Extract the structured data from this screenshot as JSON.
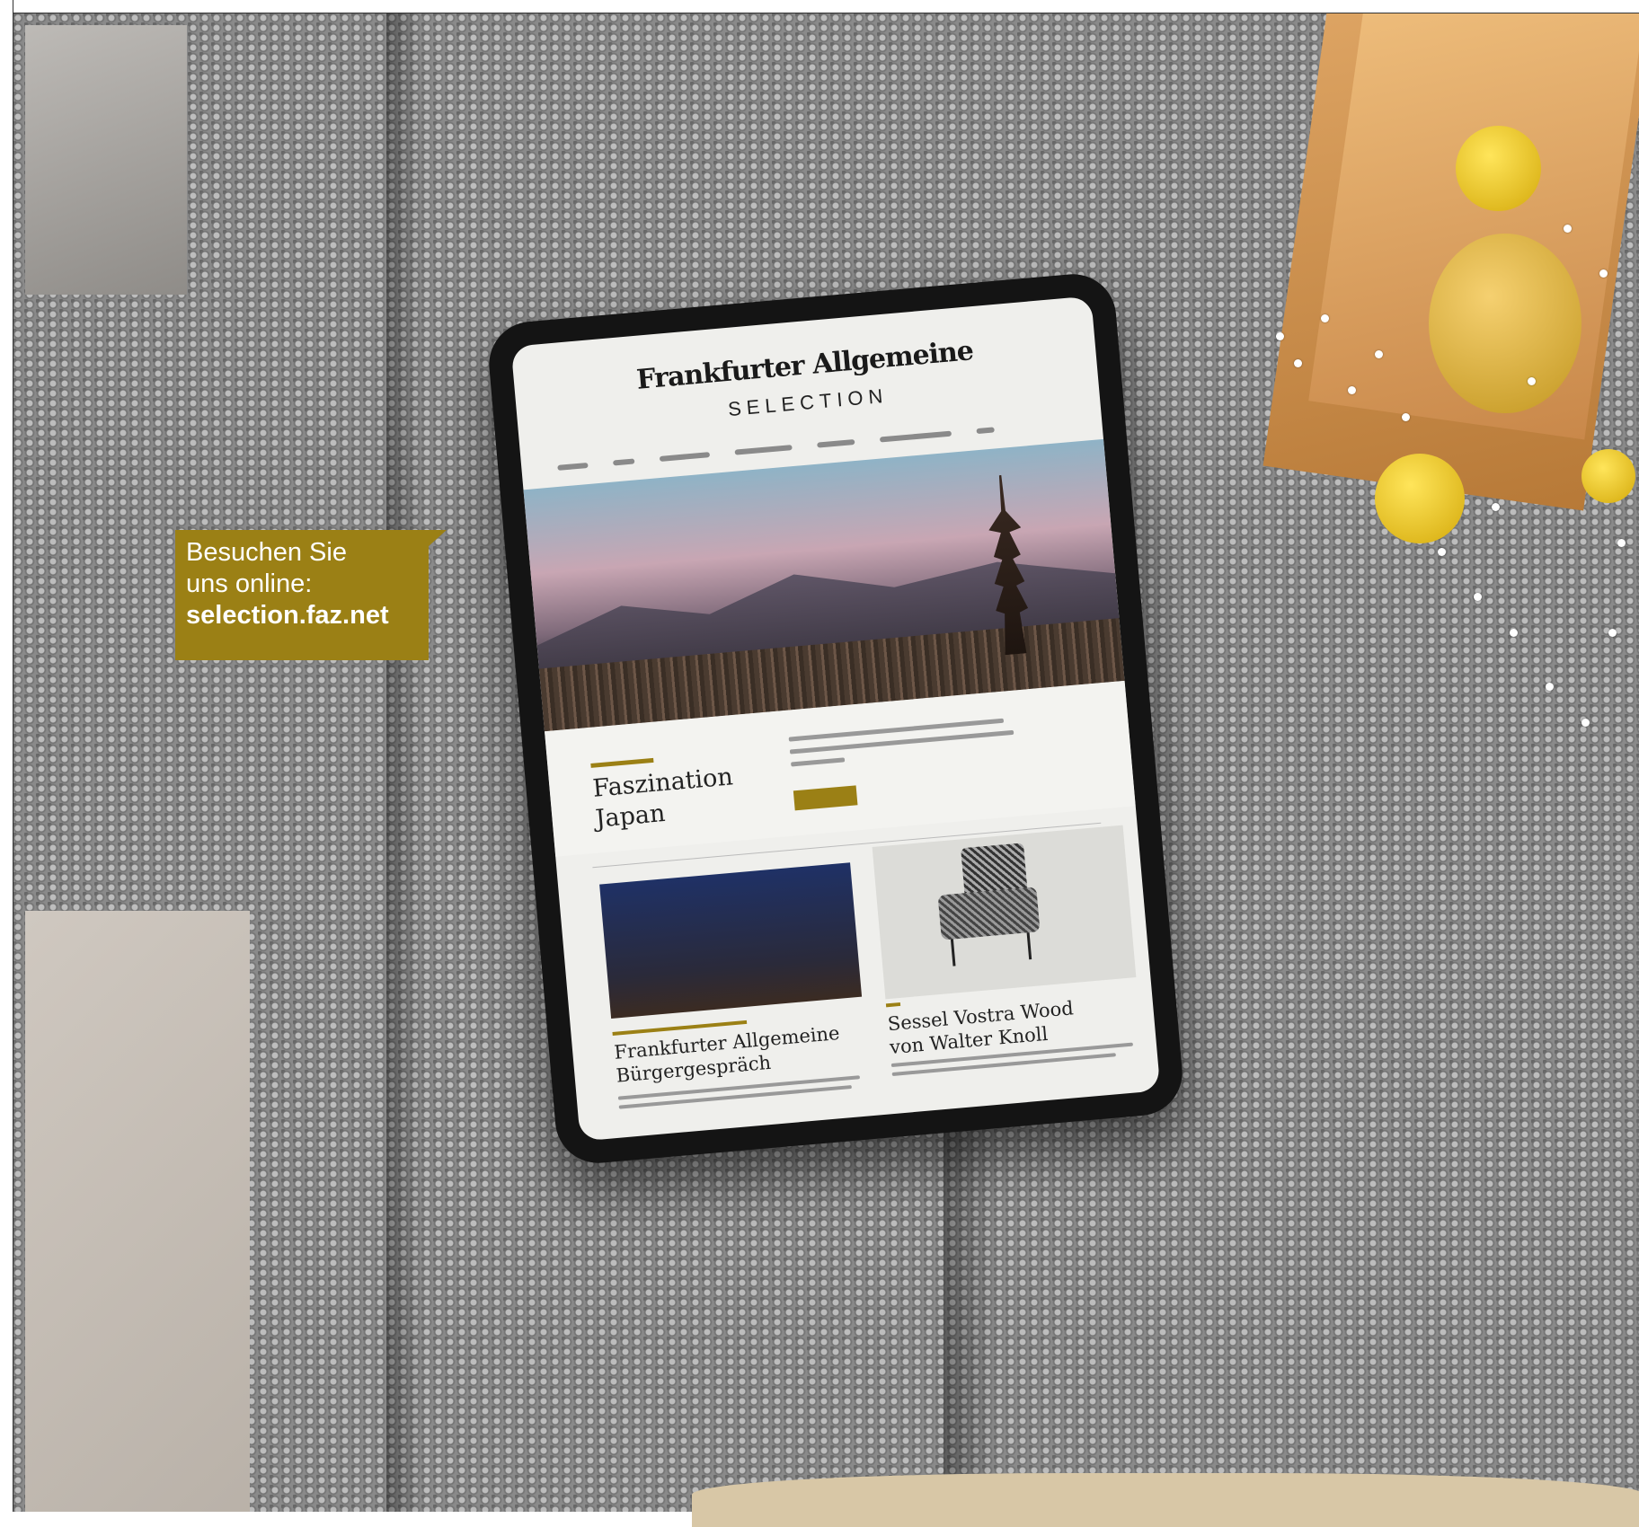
{
  "callout": {
    "line1": "Besuchen Sie",
    "line2": "uns online:",
    "url": "selection.faz.net"
  },
  "tablet": {
    "logo": "Frankfurter Allgemeine",
    "brand": "SELECTION",
    "feature_title_line1": "Faszination",
    "feature_title_line2": "Japan",
    "card1_title_line1": "Frankfurter Allgemeine",
    "card1_title_line2": "Bürgergespräch",
    "card2_title_line1": "Sessel Vostra Wood",
    "card2_title_line2": "von Walter Knoll"
  },
  "colors": {
    "accent": "#9b8015",
    "knit": "#8a8a8a",
    "tablet_bezel": "#141414"
  }
}
